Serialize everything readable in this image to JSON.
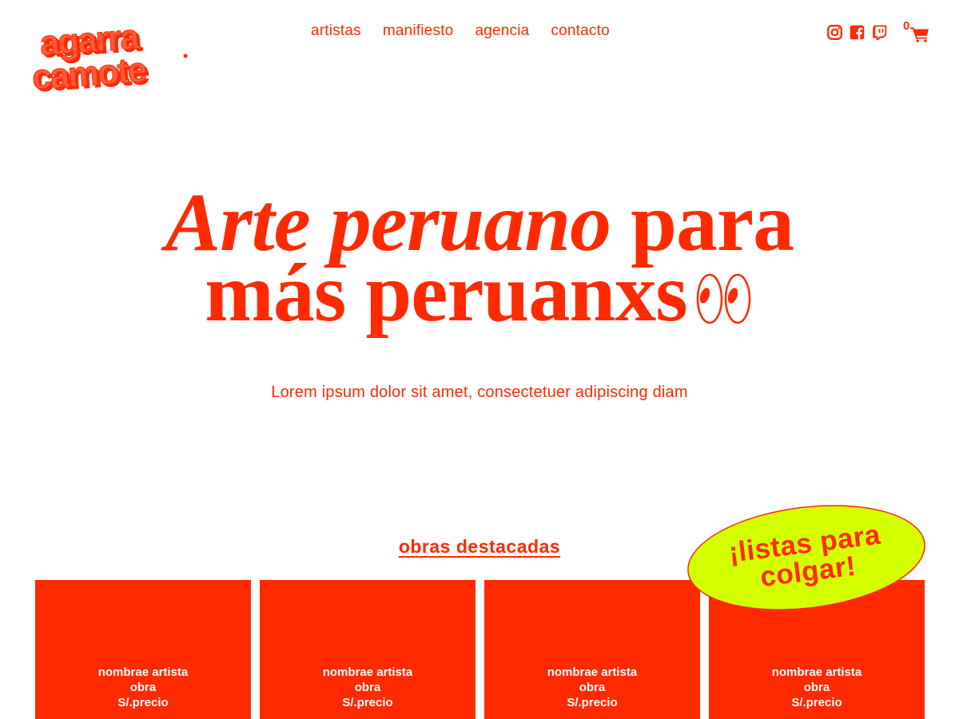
{
  "brand": {
    "logo_line1": "agarra",
    "logo_line2": "camote",
    "color": "#ff2a00"
  },
  "nav": {
    "items": [
      "artistas",
      "manifiesto",
      "agencia",
      "contacto"
    ]
  },
  "header_icons": [
    "instagram-icon",
    "facebook-icon",
    "twitch-icon"
  ],
  "cart": {
    "count": "0"
  },
  "hero": {
    "title_italic": "Arte peruano",
    "title_regular": "para",
    "title_line2": "más peruanxs",
    "subtitle": "Lorem ipsum dolor sit amet, consectetuer adipiscing diam"
  },
  "featured": {
    "title": "obras destacadas",
    "sticker_line1": "¡listas para",
    "sticker_line2": "colgar!",
    "sticker_color": "#d4ff00",
    "cards": [
      {
        "artist": "nombrae artista",
        "work": "obra",
        "price": "S/.precio"
      },
      {
        "artist": "nombrae artista",
        "work": "obra",
        "price": "S/.precio"
      },
      {
        "artist": "nombrae artista",
        "work": "obra",
        "price": "S/.precio"
      },
      {
        "artist": "nombrae artista",
        "work": "obra",
        "price": "S/.precio"
      }
    ]
  }
}
